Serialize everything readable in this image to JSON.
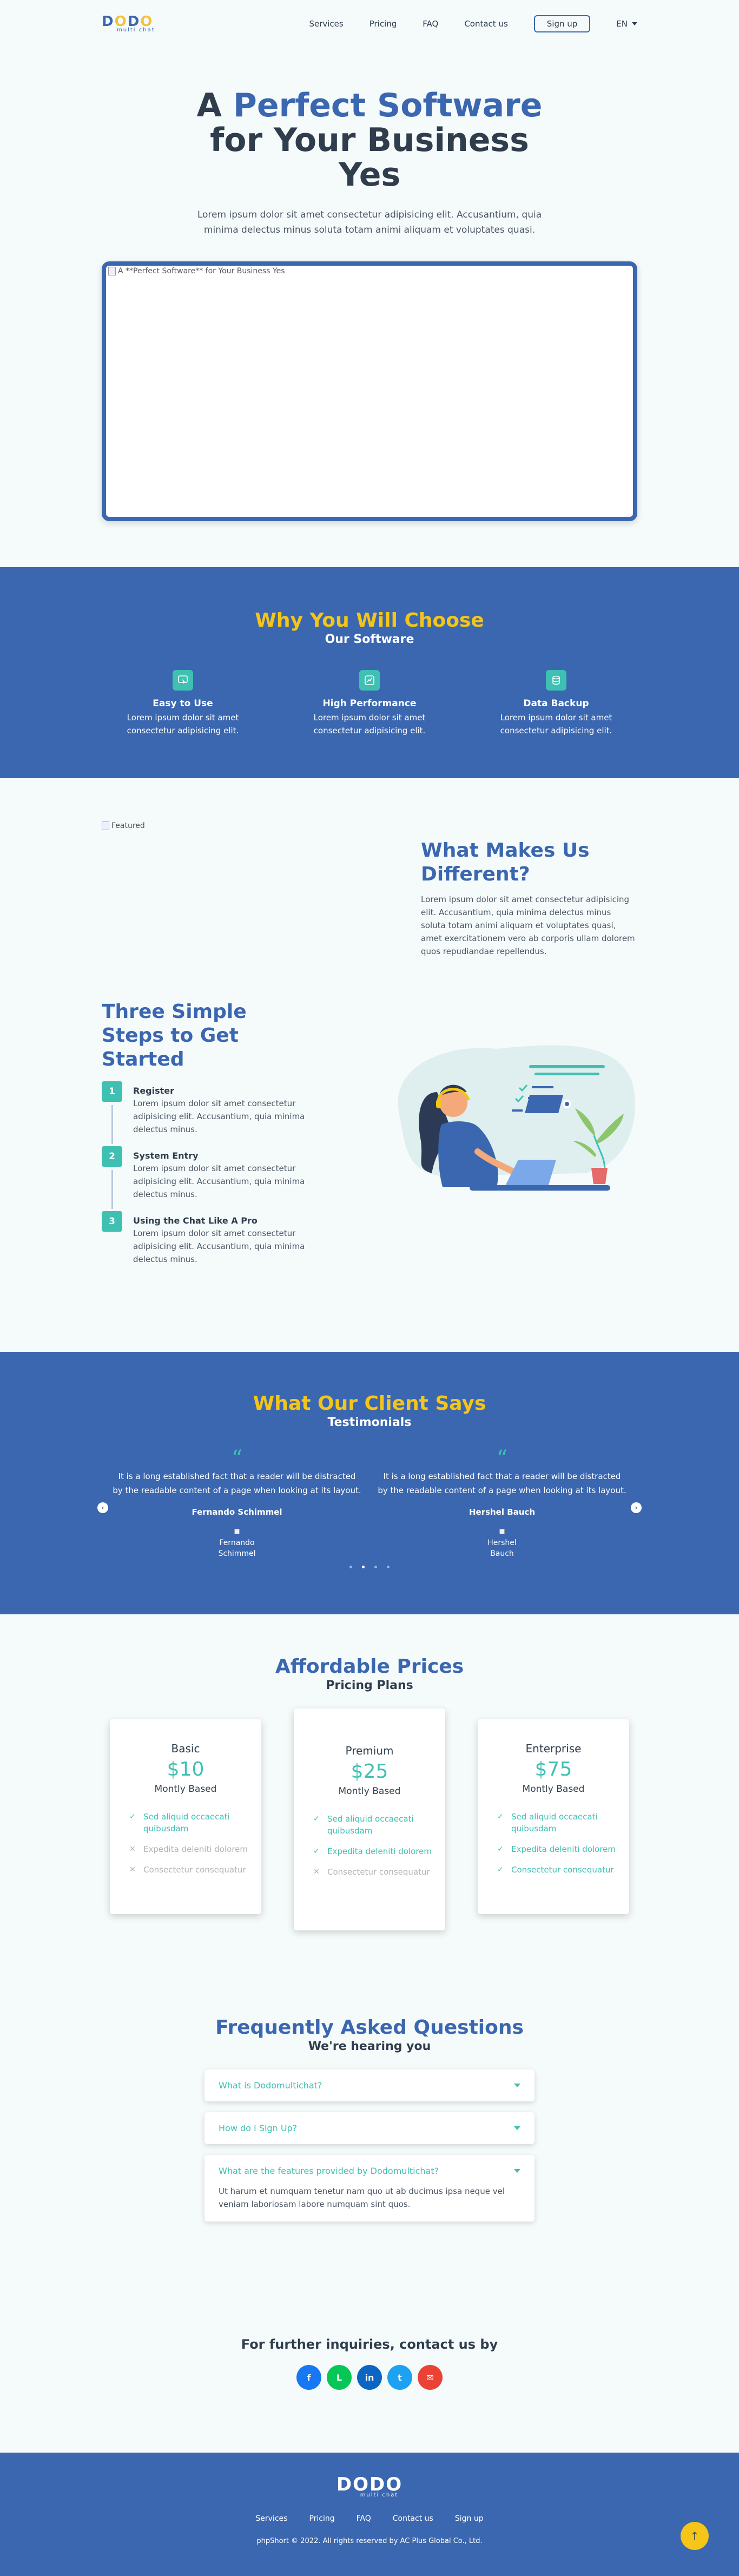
{
  "brand": {
    "logo_main": "DODO",
    "logo_sub": "multi chat"
  },
  "nav": {
    "items": [
      "Services",
      "Pricing",
      "FAQ",
      "Contact us"
    ],
    "signup": "Sign up",
    "lang": "EN"
  },
  "hero": {
    "title_pre": "A",
    "title_accent": "Perfect Software",
    "title_post": "for Your Business Yes",
    "text": "Lorem ipsum dolor sit amet consectetur adipisicing elit. Accusantium, quia minima delectus minus soluta totam animi aliquam et voluptates quasi.",
    "image_alt": "A **Perfect Software** for Your Business Yes"
  },
  "why": {
    "title": "Why You Will Choose",
    "subtitle": "Our Software",
    "features": [
      {
        "icon": "cursor-click-icon",
        "title": "Easy to Use",
        "text": "Lorem ipsum dolor sit amet consectetur adipisicing elit."
      },
      {
        "icon": "performance-icon",
        "title": "High Performance",
        "text": "Lorem ipsum dolor sit amet consectetur adipisicing elit."
      },
      {
        "icon": "database-icon",
        "title": "Data Backup",
        "text": "Lorem ipsum dolor sit amet consectetur adipisicing elit."
      }
    ]
  },
  "different": {
    "image_alt": "Featured",
    "title": "What Makes Us Different?",
    "text": "Lorem ipsum dolor sit amet consectetur adipisicing elit. Accusantium, quia minima delectus minus soluta totam animi aliquam et voluptates quasi, amet exercitationem vero ab corporis ullam dolorem quos repudiandae repellendus."
  },
  "steps": {
    "title": "Three Simple Steps to Get Started",
    "items": [
      {
        "num": "1",
        "title": "Register",
        "text": "Lorem ipsum dolor sit amet consectetur adipisicing elit. Accusantium, quia minima delectus minus."
      },
      {
        "num": "2",
        "title": "System Entry",
        "text": "Lorem ipsum dolor sit amet consectetur adipisicing elit. Accusantium, quia minima delectus minus."
      },
      {
        "num": "3",
        "title": "Using the Chat Like A Pro",
        "text": "Lorem ipsum dolor sit amet consectetur adipisicing elit. Accusantium, quia minima delectus minus."
      }
    ]
  },
  "testimonials": {
    "title": "What Our Client Says",
    "subtitle": "Testimonials",
    "items": [
      {
        "quote": "It is a long established fact that a reader will be distracted by the readable content of a page when looking at its layout.",
        "name": "Fernando Schimmel",
        "photo_alt": "Fernando Schimmel"
      },
      {
        "quote": "It is a long established fact that a reader will be distracted by the readable content of a page when looking at its layout.",
        "name": "Hershel Bauch",
        "photo_alt": "Hershel Bauch"
      }
    ],
    "quote_mark": "“",
    "dots": 4,
    "active_dot": 1
  },
  "pricing": {
    "title": "Affordable Prices",
    "subtitle": "Pricing Plans",
    "plans": [
      {
        "name": "Basic",
        "price": "$10",
        "basis": "Montly Based",
        "features": [
          {
            "text": "Sed aliquid occaecati quibusdam",
            "on": true
          },
          {
            "text": "Expedita deleniti dolorem",
            "on": false
          },
          {
            "text": "Consectetur consequatur",
            "on": false
          }
        ]
      },
      {
        "name": "Premium",
        "price": "$25",
        "basis": "Montly Based",
        "features": [
          {
            "text": "Sed aliquid occaecati quibusdam",
            "on": true
          },
          {
            "text": "Expedita deleniti dolorem",
            "on": true
          },
          {
            "text": "Consectetur consequatur",
            "on": false
          }
        ]
      },
      {
        "name": "Enterprise",
        "price": "$75",
        "basis": "Montly Based",
        "features": [
          {
            "text": "Sed aliquid occaecati quibusdam",
            "on": true
          },
          {
            "text": "Expedita deleniti dolorem",
            "on": true
          },
          {
            "text": "Consectetur consequatur",
            "on": true
          }
        ]
      }
    ]
  },
  "faq": {
    "title": "Frequently Asked Questions",
    "subtitle": "We're hearing you",
    "items": [
      {
        "q": "What is Dodomultichat?",
        "a": ""
      },
      {
        "q": "How do I Sign Up?",
        "a": ""
      },
      {
        "q": "What are the features provided by Dodomultichat?",
        "a": "Ut harum et numquam tenetur nam quo ut ab ducimus ipsa neque vel veniam laboriosam labore numquam sint quos."
      }
    ]
  },
  "contact": {
    "title": "For further inquiries, contact us by",
    "socials": [
      {
        "icon": "facebook-icon",
        "glyph": "f",
        "color": "#1877f2"
      },
      {
        "icon": "line-icon",
        "glyph": "L",
        "color": "#06c755"
      },
      {
        "icon": "linkedin-icon",
        "glyph": "in",
        "color": "#0a66c2"
      },
      {
        "icon": "twitter-icon",
        "glyph": "t",
        "color": "#1da1f2"
      },
      {
        "icon": "email-icon",
        "glyph": "✉",
        "color": "#ea4335"
      }
    ]
  },
  "footer": {
    "nav": [
      "Services",
      "Pricing",
      "FAQ",
      "Contact us",
      "Sign up"
    ],
    "copyright": "phpShort © 2022. All rights reserved by AC Plus Global Co., Ltd.",
    "to_top": "↑"
  },
  "colors": {
    "primary": "#3b67b0",
    "accent_yellow": "#f5c518",
    "teal": "#3fc0b3"
  }
}
